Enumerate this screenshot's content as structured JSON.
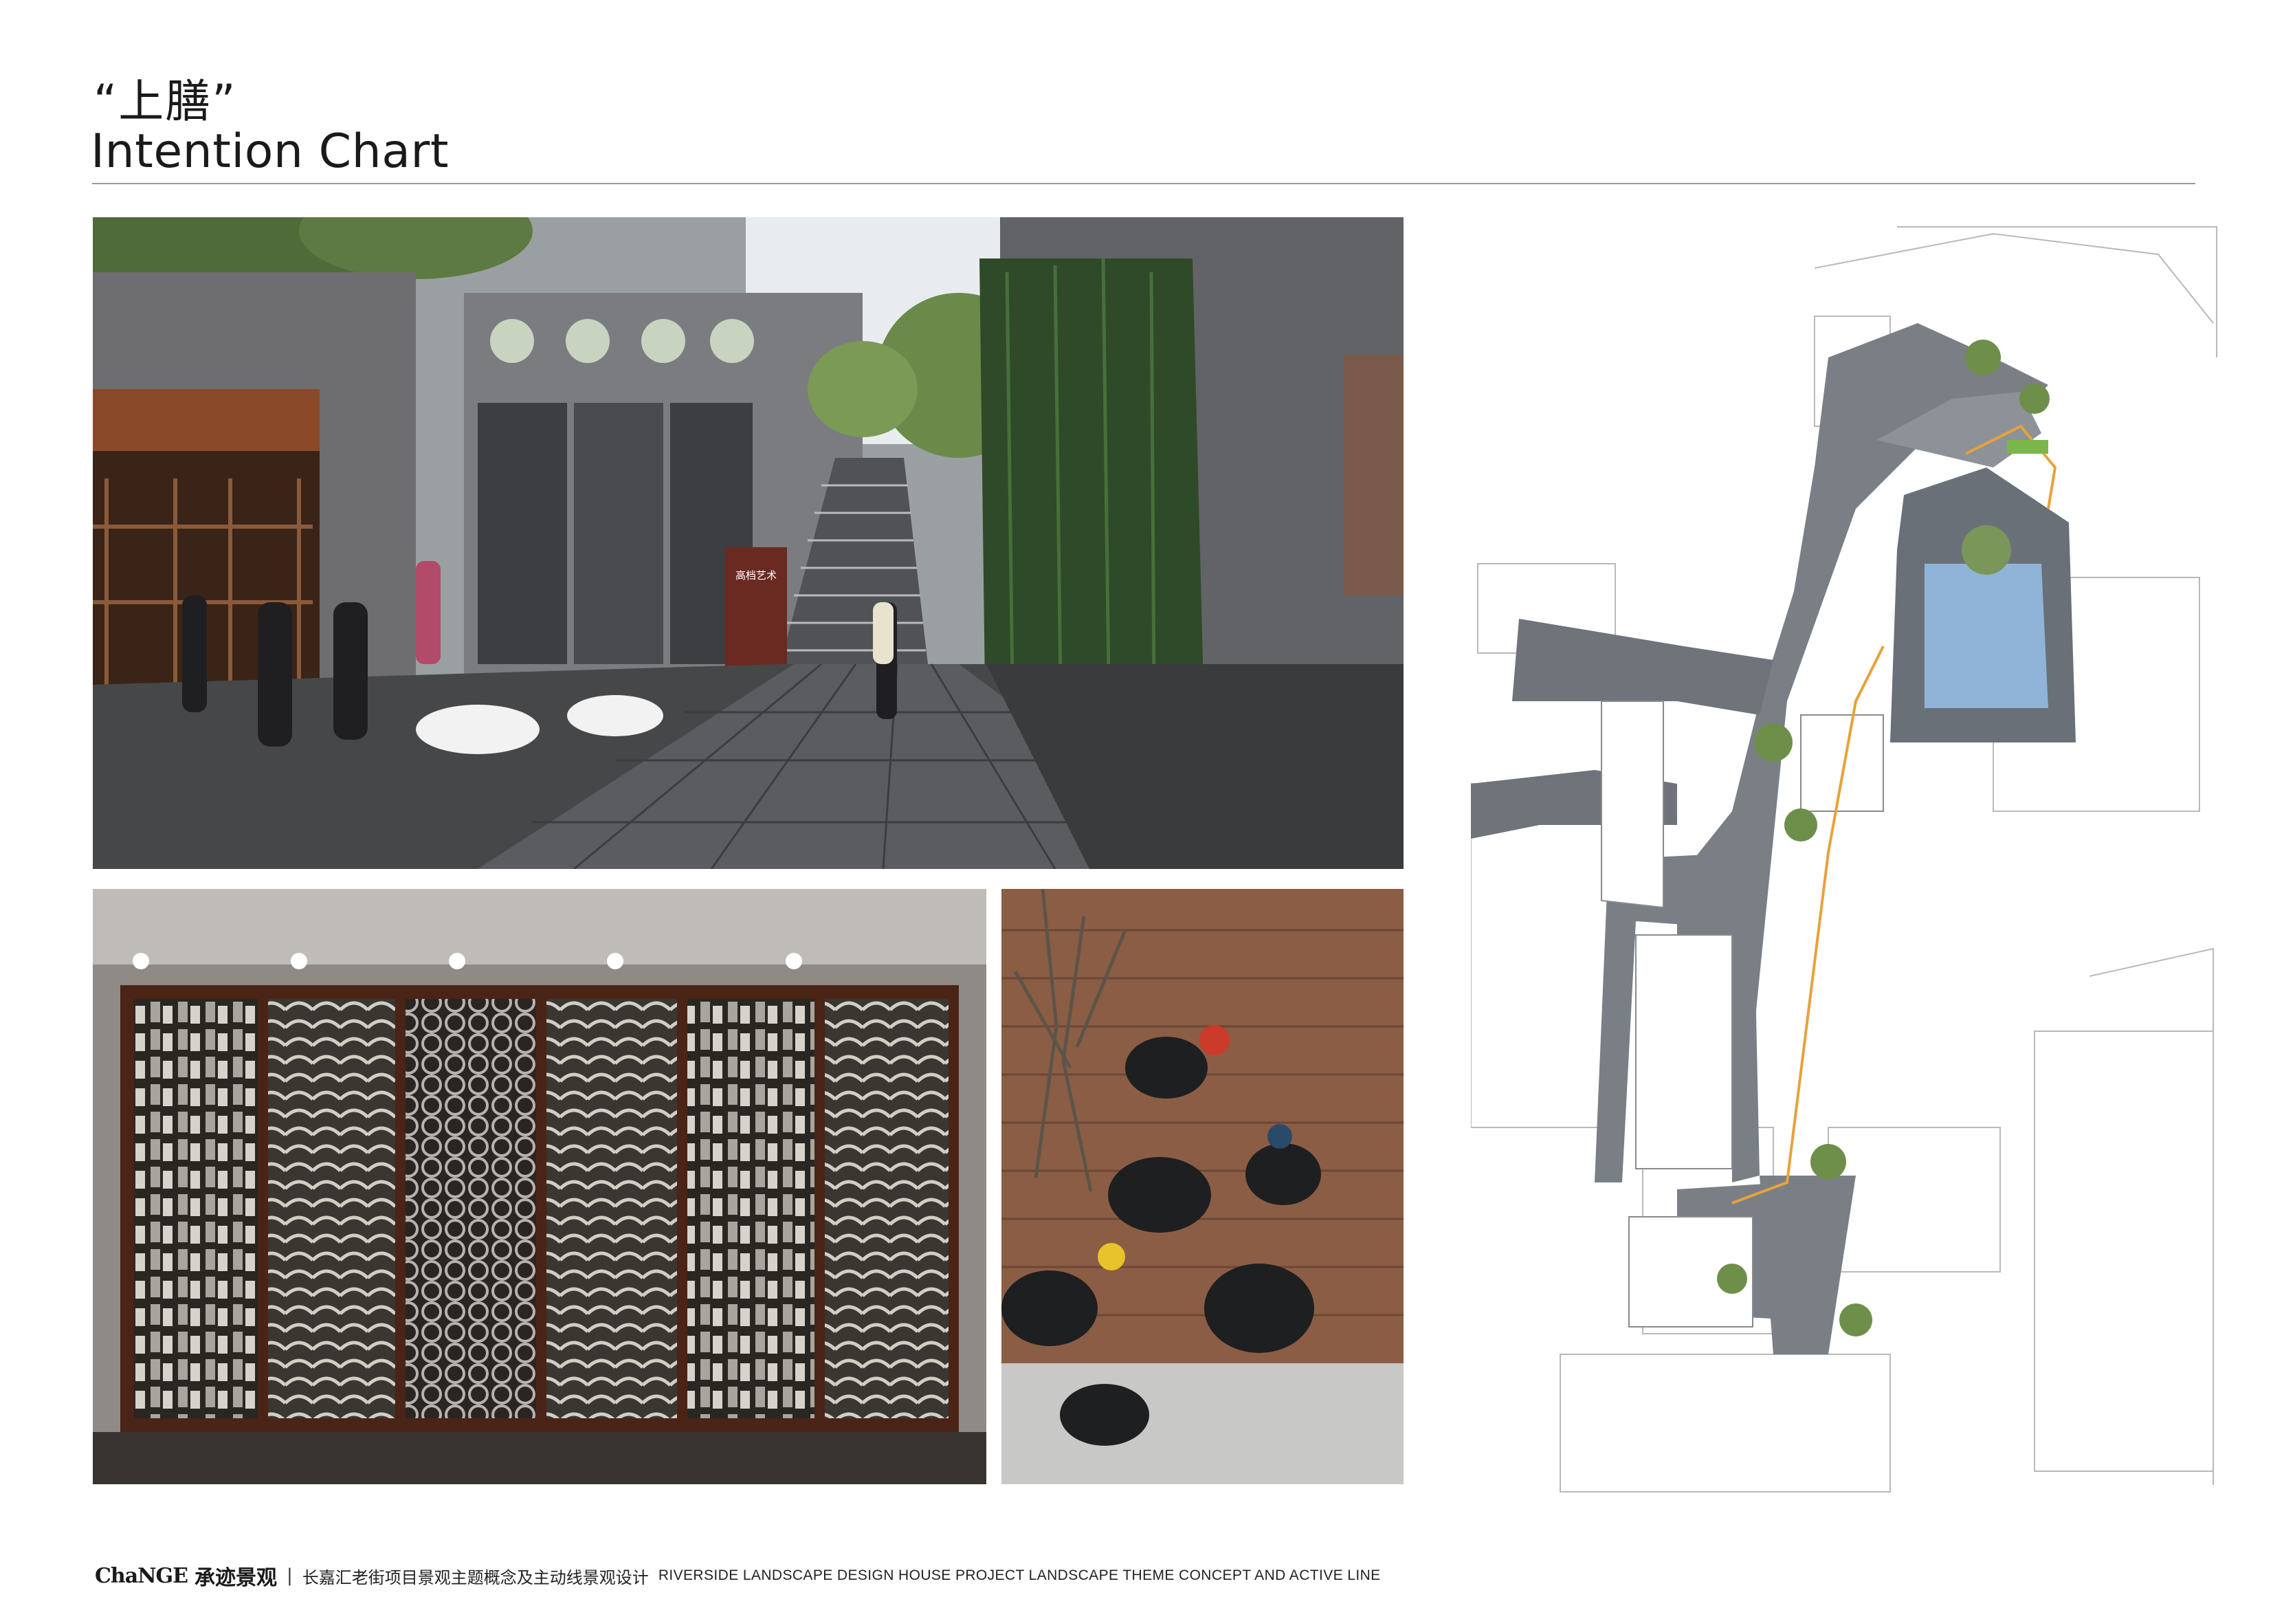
{
  "header": {
    "title_cn": "“上膳”",
    "title_en": "Intention Chart"
  },
  "images": {
    "street_sign_text": "高档艺术"
  },
  "footer": {
    "logo_mark": "ChaNGE",
    "logo_cn": "承迹景观",
    "separator": "|",
    "project_cn": "长嘉汇老街项目景观主题概念及主动线景观设计",
    "project_en": "RIVERSIDE LANDSCAPE DESIGN HOUSE PROJECT LANDSCAPE THEME CONCEPT AND ACTIVE LINE"
  },
  "colors": {
    "accent_orange": "#e8a23a",
    "plan_paving": "#7a7f86",
    "plan_water": "#8fb4d8",
    "brick_grey": "#6b6b6b",
    "wood_frame": "#5a2e1c"
  }
}
